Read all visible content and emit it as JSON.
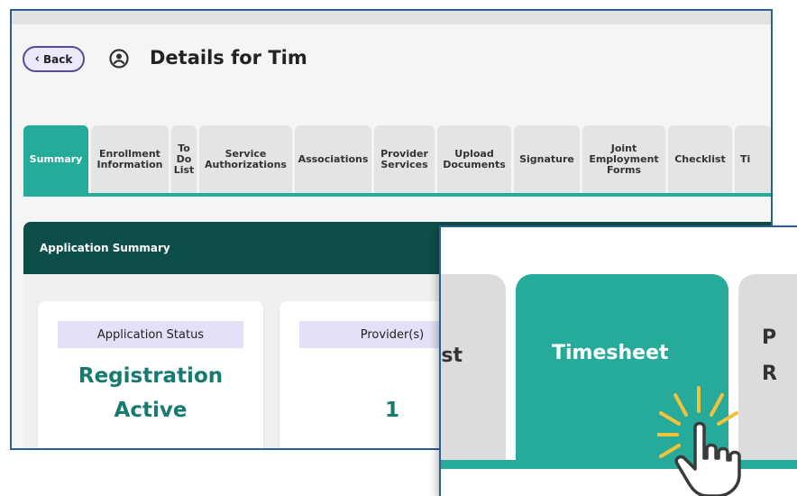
{
  "header": {
    "back_label": "Back",
    "title": "Details for Tim"
  },
  "tabs": [
    {
      "label": "Summary",
      "active": true
    },
    {
      "label": "Enrollment\nInformation"
    },
    {
      "label": "To\nDo\nList"
    },
    {
      "label": "Service\nAuthorizations"
    },
    {
      "label": "Associations"
    },
    {
      "label": "Provider\nServices"
    },
    {
      "label": "Upload\nDocuments"
    },
    {
      "label": "Signature"
    },
    {
      "label": "Joint\nEmployment\nForms"
    },
    {
      "label": "Checklist"
    },
    {
      "label": "Ti"
    }
  ],
  "summary": {
    "title": "Application Summary",
    "status_label": "Application Status",
    "status_value_line1": "Registration",
    "status_value_line2": "Active",
    "providers_label": "Provider(s)",
    "providers_value": "1"
  },
  "zoom": {
    "left_tab_fragment": "st",
    "active_tab": "Timesheet",
    "right_tab_line1": "P",
    "right_tab_line2": "R"
  },
  "colors": {
    "accent": "#26aa9a",
    "header_dark": "#0e4e48",
    "value_text": "#167a70",
    "frame_border": "#2a5f8f",
    "label_bg": "#e3e0f7",
    "sparkle": "#f3c23a"
  }
}
